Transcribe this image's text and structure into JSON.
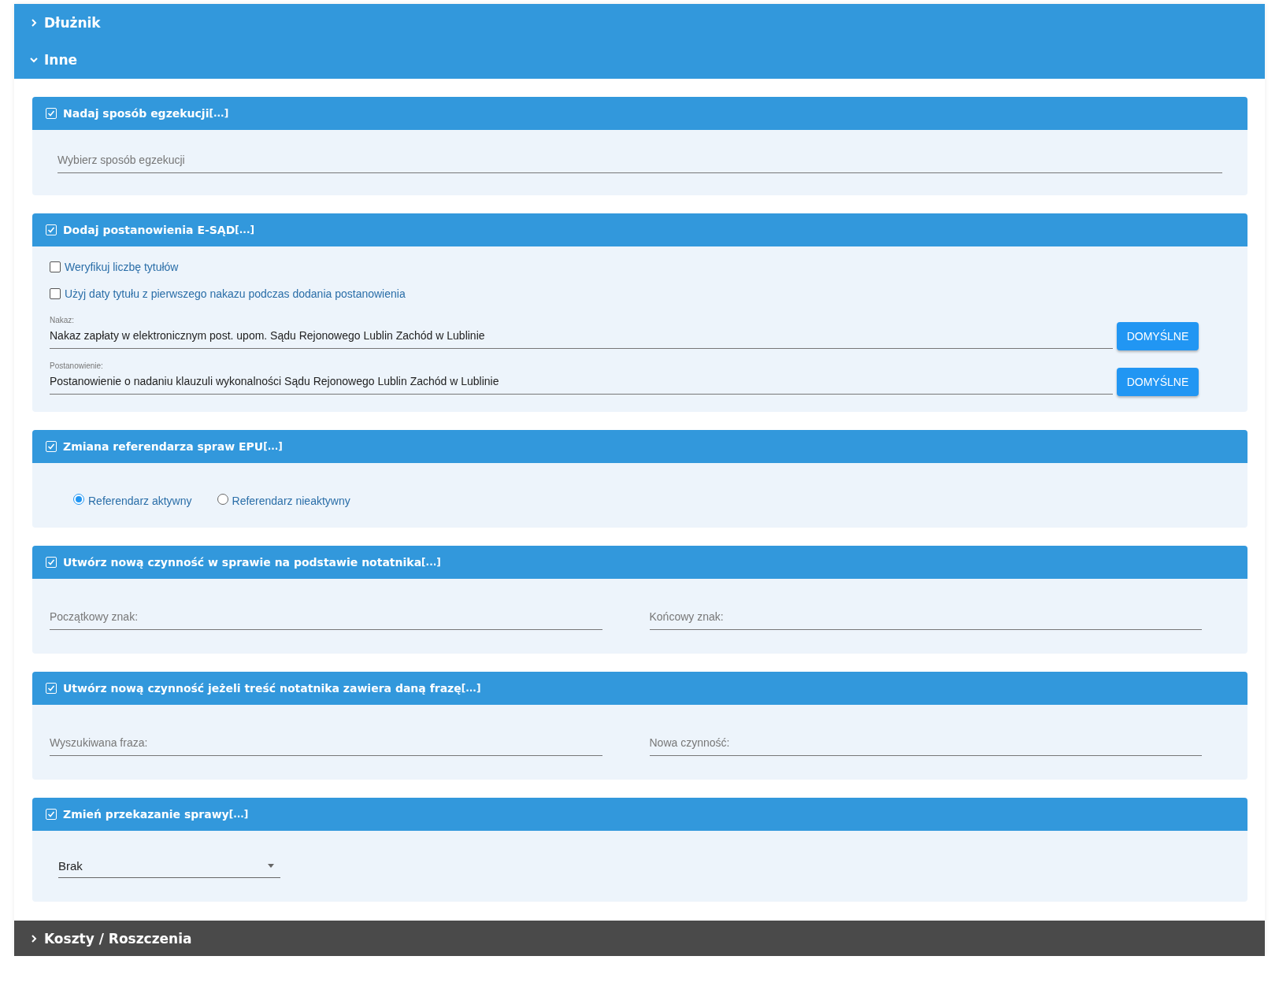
{
  "top_sections": [
    {
      "label": "Dłużnik",
      "expanded": false
    },
    {
      "label": "Inne",
      "expanded": true
    }
  ],
  "cards": [
    {
      "kind": "select",
      "checked": true,
      "title": "Nadaj sposób egzekucji",
      "suffix": "[...]",
      "placeholder": "Wybierz sposób egzekucji"
    },
    {
      "kind": "esad",
      "checked": true,
      "title": "Dodaj postanowienia E-SĄD",
      "suffix": "[...]",
      "options": [
        {
          "label": "Weryfikuj liczbę tytułów",
          "checked": false
        },
        {
          "label": "Użyj daty tytułu z pierwszego nakazu podczas dodania postanowienia",
          "checked": false
        }
      ],
      "fields": [
        {
          "label": "Nakaz:",
          "value": "Nakaz zapłaty w elektronicznym post. upom. Sądu Rejonowego Lublin Zachód w Lublinie",
          "button": "DOMYŚLNE"
        },
        {
          "label": "Postanowienie:",
          "value": "Postanowienie o nadaniu klauzuli wykonalności Sądu Rejonowego Lublin Zachód w Lublinie",
          "button": "DOMYŚLNE"
        }
      ]
    },
    {
      "kind": "radio",
      "checked": true,
      "title": "Zmiana referendarza spraw EPU",
      "suffix": "[...]",
      "radios": [
        {
          "label": "Referendarz aktywny",
          "selected": true
        },
        {
          "label": "Referendarz nieaktywny",
          "selected": false
        }
      ]
    },
    {
      "kind": "pair",
      "checked": true,
      "title": "Utwórz nową czynność w sprawie na podstawie notatnika",
      "suffix": "[...]",
      "inputs": [
        {
          "placeholder": "Początkowy znak:"
        },
        {
          "placeholder": "Końcowy znak:"
        }
      ]
    },
    {
      "kind": "pair",
      "checked": true,
      "title": "Utwórz nową czynność jeżeli treść notatnika zawiera daną frazę",
      "suffix": "[...]",
      "inputs": [
        {
          "placeholder": "Wyszukiwana fraza:"
        },
        {
          "placeholder": "Nowa czynność:"
        }
      ]
    },
    {
      "kind": "dropdown",
      "checked": true,
      "title": "Zmień przekazanie sprawy",
      "suffix": "[...]",
      "value": "Brak"
    }
  ],
  "bottom_section": {
    "label": "Koszty / Roszczenia",
    "expanded": false
  }
}
